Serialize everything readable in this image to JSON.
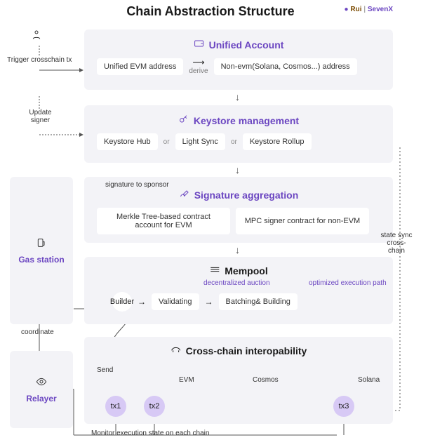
{
  "title": "Chain Abstraction Structure",
  "brand": {
    "rui": "Rui",
    "sep": "|",
    "sevenx": "SevenX"
  },
  "actor": {
    "trigger": "Trigger crosschain tx",
    "update_signer": "Update signer"
  },
  "unified": {
    "heading": "Unified Account",
    "evm": "Unified EVM address",
    "derive": "derive",
    "nonevm": "Non-evm(Solana, Cosmos...) address"
  },
  "keystore": {
    "heading": "Keystore management",
    "hub": "Keystore Hub",
    "light": "Light Sync",
    "rollup": "Keystore Rollup",
    "or": "or"
  },
  "gas_station_label": "Gas station",
  "sig": {
    "sponsor": "signature to sponsor",
    "heading": "Signature aggregation",
    "merkle": "Merkle Tree-based contract account for EVM",
    "mpc": "MPC signer contract for non-EVM"
  },
  "mempool": {
    "heading": "Mempool",
    "builder": "Builder",
    "validating": "Validating",
    "batching": "Batching& Building",
    "decentralized": "decentralized auction",
    "optimized": "optimized execution path"
  },
  "coordinate": "coordinate",
  "relayer_label": "Relayer",
  "interop": {
    "heading": "Cross-chain interopability",
    "send": "Send",
    "evm": "EVM",
    "cosmos": "Cosmos",
    "solana": "Solana",
    "tx1": "tx1",
    "tx2": "tx2",
    "tx3": "tx3"
  },
  "monitor": "Monitor execution state on each chain",
  "state_sync": "state sync cross-chain"
}
